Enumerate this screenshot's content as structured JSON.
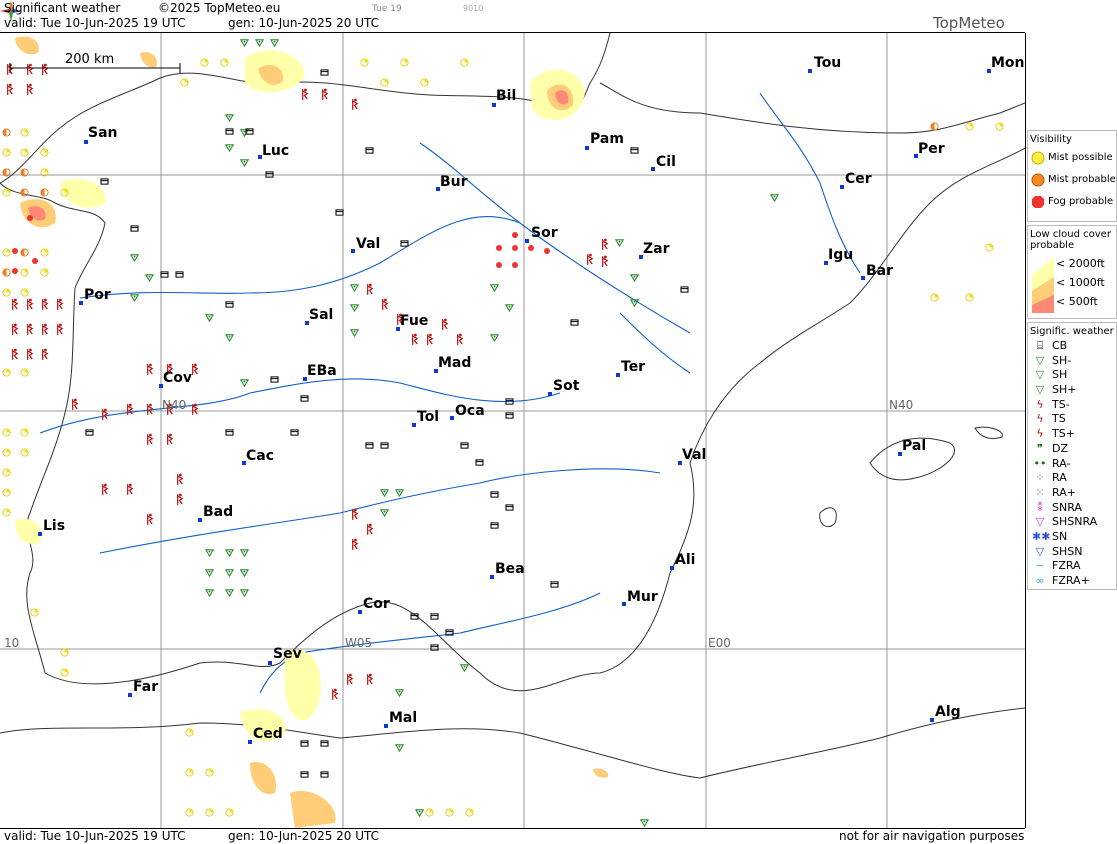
{
  "header": {
    "title": "Significant weather",
    "copyright": "©2025 TopMeteo.eu",
    "valid": "valid:  Tue  10-Jun-2025  19 UTC",
    "gen": "gen: 10-Jun-2025 20 UTC",
    "day_small": "Tue 19",
    "code_small": "9010",
    "logo": "TopMeteo"
  },
  "footer": {
    "valid": "valid:  Tue  10-Jun-2025  19 UTC",
    "gen": "gen: 10-Jun-2025 20 UTC",
    "disclaimer": "not for air navigation purposes"
  },
  "map": {
    "scale_label": "200 km",
    "grid_labels": [
      "N40",
      "N40",
      "W05",
      "E00",
      "10"
    ],
    "cities": [
      "San",
      "Luc",
      "Bur",
      "Bil",
      "Pam",
      "Cil",
      "Tou",
      "Mon",
      "Per",
      "Cer",
      "Igu",
      "Bar",
      "Sor",
      "Zar",
      "Val",
      "Por",
      "Sal",
      "Fue",
      "Mad",
      "Cov",
      "EBa",
      "Ter",
      "Sot",
      "Ocа",
      "Tol",
      "Cac",
      "Val",
      "Pal",
      "Bad",
      "Lis",
      "Bea",
      "Ali",
      "Mur",
      "Cor",
      "Sev",
      "Far",
      "Mal",
      "Ced",
      "Alg"
    ]
  },
  "legend": {
    "visibility": {
      "title": "Visibility",
      "items": [
        {
          "label": "Mist possible",
          "color": "#ffee44"
        },
        {
          "label": "Mist probable",
          "color": "#ff8822"
        },
        {
          "label": "Fog probable",
          "color": "#ee3333"
        }
      ]
    },
    "low_cloud": {
      "title": "Low cloud cover probable",
      "items": [
        {
          "label": "< 2000ft",
          "color": "#ffffaa"
        },
        {
          "label": "< 1000ft",
          "color": "#ffcc77"
        },
        {
          "label": "<  500ft",
          "color": "#ff8877"
        }
      ]
    },
    "signific": {
      "title": "Signific. weather",
      "items": [
        {
          "label": "CB",
          "icon": "cb-icon"
        },
        {
          "label": "SH-",
          "icon": "shower-light-icon"
        },
        {
          "label": "SH",
          "icon": "shower-icon"
        },
        {
          "label": "SH+",
          "icon": "shower-heavy-icon"
        },
        {
          "label": "TS-",
          "icon": "thunderstorm-light-icon"
        },
        {
          "label": "TS",
          "icon": "thunderstorm-icon"
        },
        {
          "label": "TS+",
          "icon": "thunderstorm-heavy-icon"
        },
        {
          "label": "DZ",
          "icon": "drizzle-icon"
        },
        {
          "label": "RA-",
          "icon": "rain-light-icon"
        },
        {
          "label": "RA",
          "icon": "rain-icon"
        },
        {
          "label": "RA+",
          "icon": "rain-heavy-icon"
        },
        {
          "label": "SNRA",
          "icon": "sleet-icon"
        },
        {
          "label": "SHSNRA",
          "icon": "sleet-shower-icon"
        },
        {
          "label": "SN",
          "icon": "snow-icon"
        },
        {
          "label": "SHSN",
          "icon": "snow-shower-icon"
        },
        {
          "label": "FZRA",
          "icon": "freezing-rain-icon"
        },
        {
          "label": "FZRA+",
          "icon": "freezing-rain-heavy-icon"
        }
      ]
    }
  }
}
